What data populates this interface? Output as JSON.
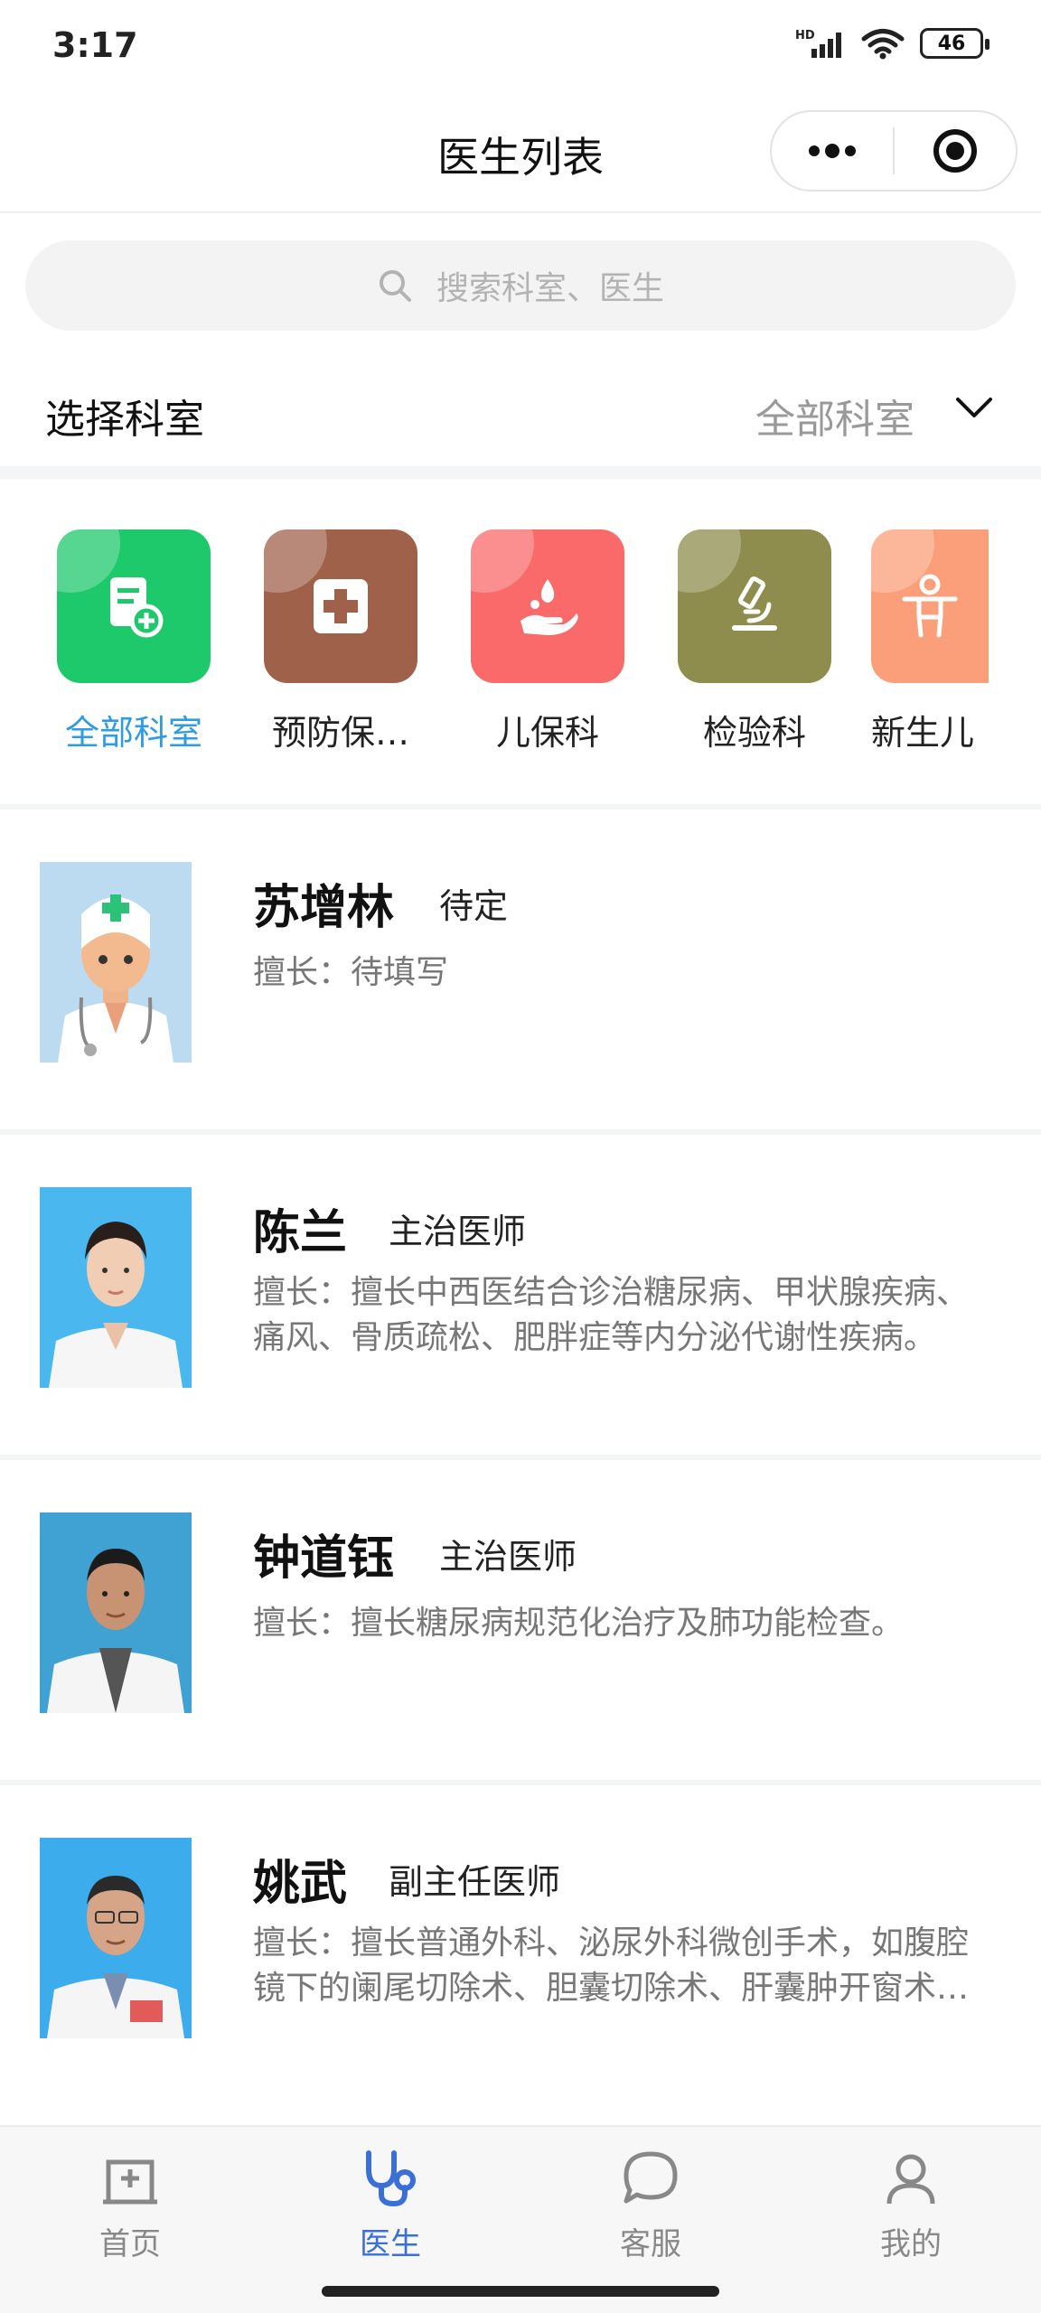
{
  "status_bar": {
    "time": "3:17",
    "network": "HD",
    "battery": "46"
  },
  "nav": {
    "title": "医生列表",
    "more_icon": "more-dots-icon",
    "close_icon": "target-icon"
  },
  "search": {
    "placeholder": "搜索科室、医生"
  },
  "department": {
    "label": "选择科室",
    "value": "全部科室"
  },
  "categories": [
    {
      "label": "全部科室",
      "color": "#1ec96b",
      "icon": "document-plus-icon",
      "active": true
    },
    {
      "label": "预防保…",
      "color": "#a0614b",
      "icon": "medical-cross-icon",
      "active": false
    },
    {
      "label": "儿保科",
      "color": "#fa6a6a",
      "icon": "hand-drop-icon",
      "active": false
    },
    {
      "label": "检验科",
      "color": "#8e8d4e",
      "icon": "microscope-icon",
      "active": false
    },
    {
      "label": "新生儿",
      "color": "#fb9f7a",
      "icon": "child-icon",
      "active": false
    }
  ],
  "doctors": [
    {
      "name": "苏增林",
      "title": "待定",
      "desc": "擅长：待填写",
      "photo": "cartoon-doctor"
    },
    {
      "name": "陈兰",
      "title": "主治医师",
      "desc": "擅长：擅长中西医结合诊治糖尿病、甲状腺疾病、痛风、骨质疏松、肥胖症等内分泌代谢性疾病。",
      "photo": "female-doctor"
    },
    {
      "name": "钟道钰",
      "title": "主治医师",
      "desc": "擅长：擅长糖尿病规范化治疗及肺功能检查。",
      "photo": "male-doctor"
    },
    {
      "name": "姚武",
      "title": "副主任医师",
      "desc": "擅长：擅长普通外科、泌尿外科微创手术，如腹腔镜下的阑尾切除术、胆囊切除术、肝囊肿开窗术等。",
      "photo": "male-doctor-glasses"
    }
  ],
  "tabs": [
    {
      "label": "首页",
      "icon": "hospital-icon",
      "active": false
    },
    {
      "label": "医生",
      "icon": "stethoscope-icon",
      "active": true
    },
    {
      "label": "客服",
      "icon": "chat-bubble-icon",
      "active": false
    },
    {
      "label": "我的",
      "icon": "user-icon",
      "active": false
    }
  ],
  "colors": {
    "accent": "#3b6fd8",
    "active_category": "#2f9be0"
  }
}
